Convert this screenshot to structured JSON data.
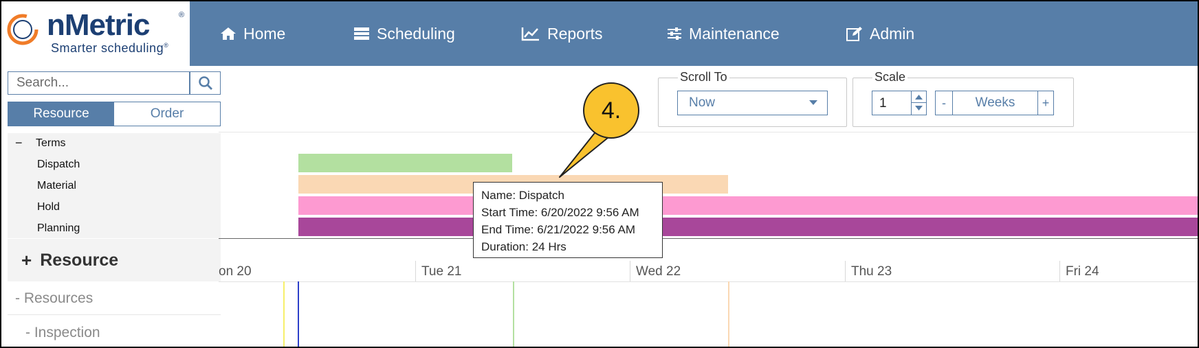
{
  "brand": {
    "name": "nMetric",
    "registered": "®",
    "tagline": "Smarter scheduling",
    "tagline_mark": "®"
  },
  "nav": [
    {
      "label": "Home",
      "icon": "home-icon"
    },
    {
      "label": "Scheduling",
      "icon": "scheduling-icon"
    },
    {
      "label": "Reports",
      "icon": "chart-icon"
    },
    {
      "label": "Maintenance",
      "icon": "sliders-icon"
    },
    {
      "label": "Admin",
      "icon": "edit-icon"
    }
  ],
  "search": {
    "placeholder": "Search...",
    "value": ""
  },
  "view_toggle": {
    "resource": "Resource",
    "order": "Order"
  },
  "terms": {
    "collapse_symbol": "−",
    "header": "Terms",
    "items": [
      "Dispatch",
      "Material",
      "Hold",
      "Planning"
    ]
  },
  "resource_section": {
    "expand_symbol": "+",
    "label": "Resource"
  },
  "resource_tree": [
    {
      "label": "- Resources"
    },
    {
      "label": "- Inspection"
    }
  ],
  "scroll_to": {
    "legend": "Scroll To",
    "selected": "Now"
  },
  "scale": {
    "legend": "Scale",
    "value": "1",
    "minus": "-",
    "unit": "Weeks",
    "plus": "+"
  },
  "dates": [
    "on 20",
    "Tue 21",
    "Wed 22",
    "Thu 23",
    "Fri 24"
  ],
  "bar_colors": {
    "dispatch": "#b3e0a0",
    "material": "#fad8b4",
    "hold": "#fd9ad1",
    "planning": "#a8479a"
  },
  "tooltip": {
    "name": "Name: Dispatch",
    "start": "Start Time: 6/20/2022 9:56 AM",
    "end": "End Time: 6/21/2022 9:56 AM",
    "duration": "Duration: 24 Hrs"
  },
  "callout": {
    "label": "4."
  },
  "colors": {
    "nav_bg": "#577ea8",
    "brand_blue": "#1c3f73",
    "callout_yellow": "#f9c22e"
  }
}
